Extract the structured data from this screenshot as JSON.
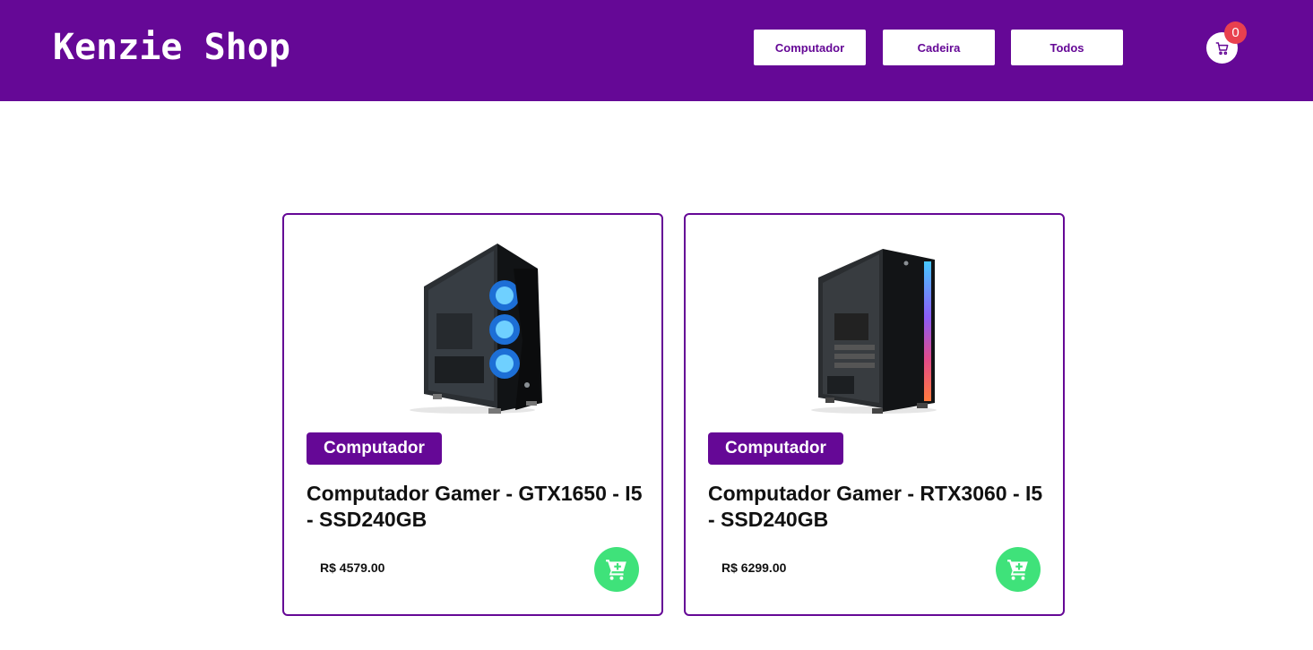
{
  "header": {
    "logo": "Kenzie Shop",
    "nav": [
      "Computador",
      "Cadeira",
      "Todos"
    ],
    "cart_count": "0",
    "cart_icon": "shopping-cart-icon",
    "colors": {
      "brand": "#650896",
      "badge": "#e8404f",
      "add": "#3fe27a"
    }
  },
  "products": [
    {
      "category": "Computador",
      "title": "Computador Gamer - GTX1650 - I5 - SSD240GB",
      "price": "R$ 4579.00",
      "image": "pc-case-blue-fans"
    },
    {
      "category": "Computador",
      "title": "Computador Gamer - RTX3060 - I5 - SSD240GB",
      "price": "R$ 6299.00",
      "image": "pc-case-rgb-strip"
    }
  ]
}
